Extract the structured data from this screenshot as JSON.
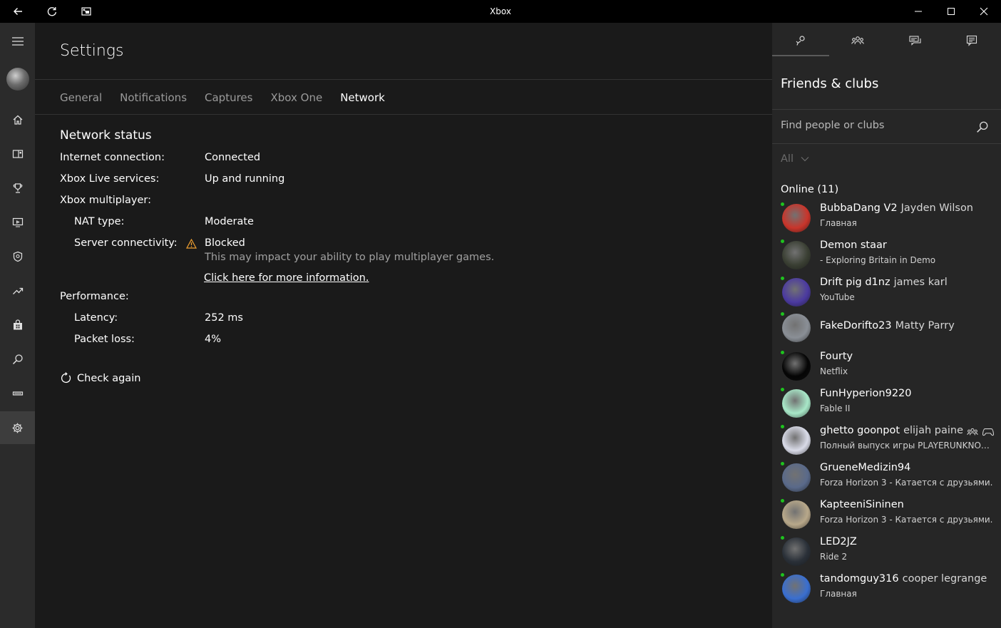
{
  "window": {
    "title": "Xbox"
  },
  "titlebar": {
    "icons": [
      "back-arrow-icon",
      "refresh-icon",
      "compact-overlay-icon",
      "minimize-icon",
      "maximize-icon",
      "close-icon"
    ]
  },
  "rail": {
    "icons": [
      "hamburger-icon",
      "avatar",
      "home-icon",
      "my-games-icon",
      "achievements-icon",
      "game-dvr-icon",
      "clubs-icon",
      "trending-icon",
      "store-icon",
      "search-icon",
      "connect-icon",
      "settings-icon"
    ],
    "active": "settings-icon"
  },
  "main": {
    "title": "Settings",
    "tabs": [
      {
        "label": "General"
      },
      {
        "label": "Notifications"
      },
      {
        "label": "Captures"
      },
      {
        "label": "Xbox One"
      },
      {
        "label": "Network"
      }
    ],
    "active_tab": "Network",
    "network": {
      "section_title": "Network status",
      "internet_label": "Internet connection:",
      "internet_value": "Connected",
      "live_label": "Xbox Live services:",
      "live_value": "Up and running",
      "multiplayer_label": "Xbox multiplayer:",
      "nat_label": "NAT type:",
      "nat_value": "Moderate",
      "server_label": "Server connectivity:",
      "server_value": "Blocked",
      "server_note": "This may impact your ability to play multiplayer games.",
      "more_info_link": "Click here for more information.",
      "performance_label": "Performance:",
      "latency_label": "Latency:",
      "latency_value": "252 ms",
      "packet_loss_label": "Packet loss:",
      "packet_loss_value": "4%",
      "check_again": "Check again"
    }
  },
  "pane": {
    "tabs": [
      "friends-icon",
      "party-icon",
      "messages-icon",
      "activity-feed-icon"
    ],
    "title": "Friends & clubs",
    "search_placeholder": "Find people or clubs",
    "filter_label": "All",
    "online_header": "Online (11)",
    "friends": [
      {
        "gamertag": "BubbaDang V2",
        "real_name": "Jayden Wilson",
        "activity": "Главная",
        "avatar_color": "#c9352b"
      },
      {
        "gamertag": "Demon staar",
        "real_name": "",
        "activity": " - Exploring Britain in Demo",
        "avatar_color": "#3a3f33"
      },
      {
        "gamertag": "Drift pig d1nz",
        "real_name": "james karl",
        "activity": "YouTube",
        "avatar_color": "#4b3aa0"
      },
      {
        "gamertag": "FakeDorifto23",
        "real_name": "Matty Parry",
        "activity": "",
        "avatar_color": "#8a8f96"
      },
      {
        "gamertag": "Fourty",
        "real_name": "",
        "activity": "Netflix",
        "avatar_color": "#050505"
      },
      {
        "gamertag": "FunHyperion9220",
        "real_name": "",
        "activity": "Fable II",
        "avatar_color": "#a8e8c8"
      },
      {
        "gamertag": "ghetto goonpot",
        "real_name": "elijah paine",
        "activity": "Полный выпуск игры PLAYERUNKNOWN'S BATTLEGROUNDS",
        "avatar_color": "#d9dbe8",
        "icons": [
          "party-icon",
          "controller-icon"
        ]
      },
      {
        "gamertag": "GrueneMedizin94",
        "real_name": "",
        "activity": "Forza Horizon 3 - Катается с друзьями.",
        "avatar_color": "#5a6a8a"
      },
      {
        "gamertag": "KapteeniSininen",
        "real_name": "",
        "activity": "Forza Horizon 3 - Катается с друзьями.",
        "avatar_color": "#b8a88a"
      },
      {
        "gamertag": "LED2JZ",
        "real_name": "",
        "activity": "Ride 2",
        "avatar_color": "#2a3038"
      },
      {
        "gamertag": "tandomguy316",
        "real_name": "cooper legrange",
        "activity": "Главная",
        "avatar_color": "#3a6fd0"
      }
    ]
  }
}
